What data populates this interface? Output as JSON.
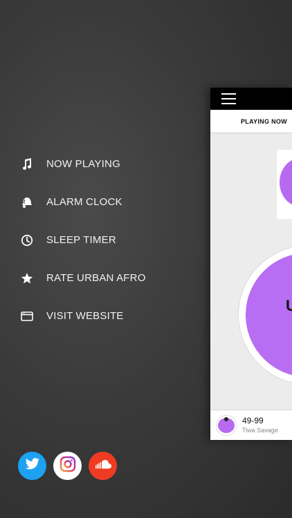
{
  "menu": {
    "items": [
      {
        "label": "NOW PLAYING",
        "icon": "music-note-icon"
      },
      {
        "label": "ALARM CLOCK",
        "icon": "alarm-bell-icon"
      },
      {
        "label": "SLEEP TIMER",
        "icon": "clock-icon"
      },
      {
        "label": "RATE URBAN AFRO",
        "icon": "star-icon"
      },
      {
        "label": "VISIT WEBSITE",
        "icon": "browser-window-icon"
      }
    ]
  },
  "social": {
    "buttons": [
      {
        "name": "twitter",
        "icon": "twitter-bird-icon",
        "color": "#1da1f2"
      },
      {
        "name": "instagram",
        "icon": "instagram-icon",
        "color": "#ffffff"
      },
      {
        "name": "soundcloud",
        "icon": "soundcloud-icon",
        "color": "#ee3b22"
      }
    ]
  },
  "app": {
    "tab_label": "PLAYING NOW",
    "accent": "#b76af0",
    "logo_text": "U",
    "now_playing": {
      "title": "49-99",
      "artist": "Tiwa Savage"
    }
  }
}
